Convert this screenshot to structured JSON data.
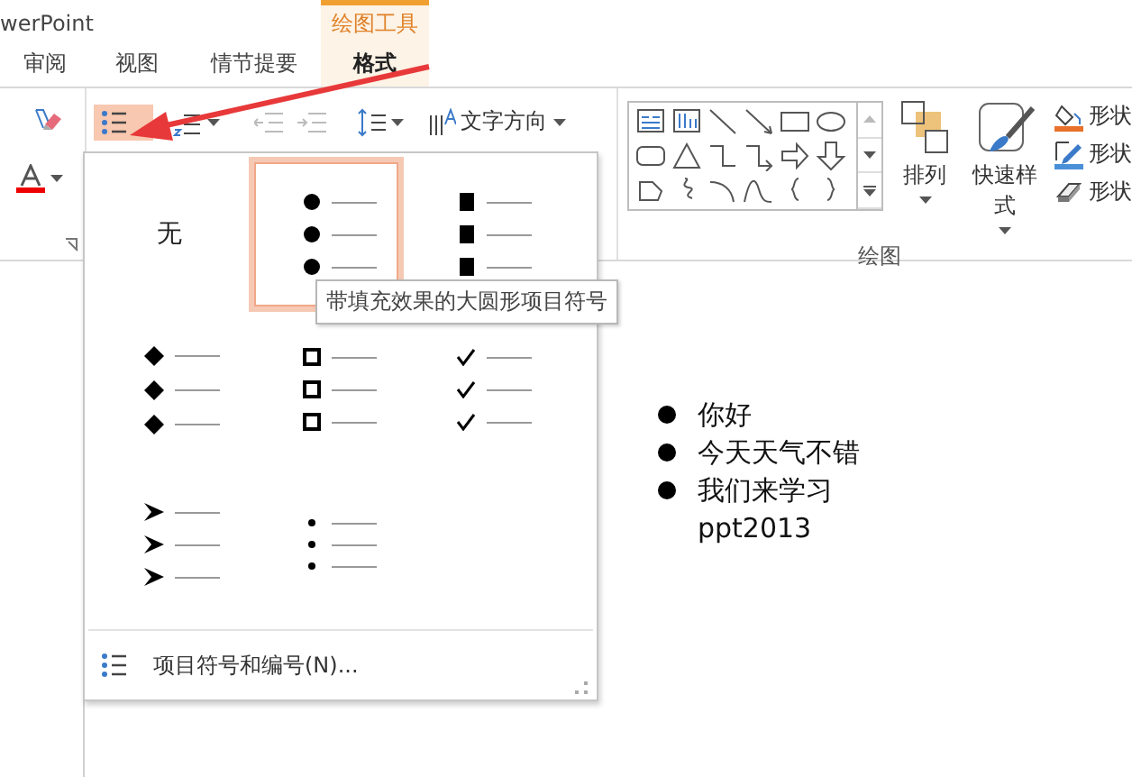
{
  "app_title": "werPoint",
  "context_tab": {
    "label": "绘图工具"
  },
  "tabs": [
    {
      "label": "审阅",
      "selected": false,
      "kind": "normal"
    },
    {
      "label": "视图",
      "selected": false,
      "kind": "normal"
    },
    {
      "label": "情节提要",
      "selected": false,
      "kind": "normal"
    },
    {
      "label": "格式",
      "selected": true,
      "kind": "contextual"
    }
  ],
  "ribbon": {
    "text_direction": "文字方向",
    "drawing_group_label": "绘图",
    "arrange": "排列",
    "quick_styles": "快速样式",
    "shape_buttons": [
      {
        "label": "形状",
        "kind": "fill"
      },
      {
        "label": "形状",
        "kind": "outline"
      },
      {
        "label": "形状",
        "kind": "effects"
      }
    ]
  },
  "bullet_gallery": {
    "items": [
      {
        "kind": "none",
        "label": "无",
        "selected": false
      },
      {
        "kind": "filled-round",
        "selected": true
      },
      {
        "kind": "filled-square",
        "selected": false
      },
      {
        "kind": "diamond",
        "selected": false
      },
      {
        "kind": "hollow-square",
        "selected": false
      },
      {
        "kind": "check",
        "selected": false
      },
      {
        "kind": "arrow",
        "selected": false
      },
      {
        "kind": "small-dot",
        "selected": false
      }
    ],
    "footer": "项目符号和编号(N)..."
  },
  "tooltip": "带填充效果的大圆形项目符号",
  "slide": {
    "bullets": [
      {
        "text": "你好"
      },
      {
        "text": "今天天气不错"
      },
      {
        "text": "我们来学习ppt2013"
      }
    ]
  }
}
